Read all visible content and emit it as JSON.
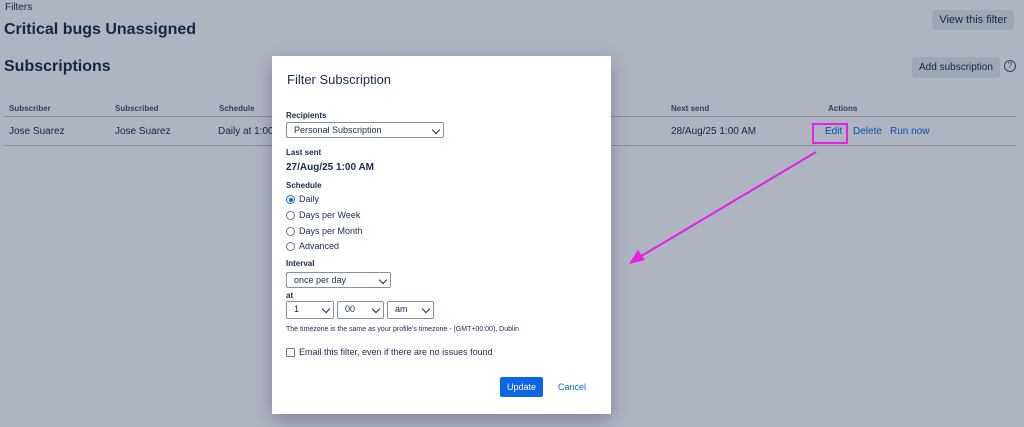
{
  "breadcrumb": "Filters",
  "page_title": "Critical bugs Unassigned",
  "view_filter_label": "View this filter",
  "subscriptions_heading": "Subscriptions",
  "add_subscription_label": "Add subscription",
  "help_icon": "?",
  "table": {
    "headers": [
      "Subscriber",
      "Subscribed",
      "Schedule",
      "Next send",
      "Actions"
    ],
    "row": {
      "subscriber": "Jose Suarez",
      "subscribed": "Jose Suarez",
      "schedule": "Daily at 1:00",
      "next_send": "28/Aug/25 1:00 AM",
      "actions": [
        "Edit",
        "Delete",
        "Run now"
      ]
    }
  },
  "modal": {
    "title": "Filter Subscription",
    "recipients_label": "Recipients",
    "recipients_value": "Personal Subscription",
    "last_sent_label": "Last sent",
    "last_sent_value": "27/Aug/25 1:00 AM",
    "schedule_label": "Schedule",
    "schedule_options": [
      "Daily",
      "Days per Week",
      "Days per Month",
      "Advanced"
    ],
    "schedule_selected": "Daily",
    "interval_label": "Interval",
    "interval_value": "once per day",
    "at_label": "at",
    "hour_value": "1",
    "minute_value": "00",
    "ampm_value": "am",
    "timezone_text": "The timezone is the same as your profile's timezone - (GMT+00:00), Dublin",
    "email_checkbox_label": "Email this filter, even if there are no issues found",
    "email_checked": false,
    "update_label": "Update",
    "cancel_label": "Cancel"
  },
  "colors": {
    "primary": "#0c66e4",
    "annotation": "#e91ee9"
  }
}
